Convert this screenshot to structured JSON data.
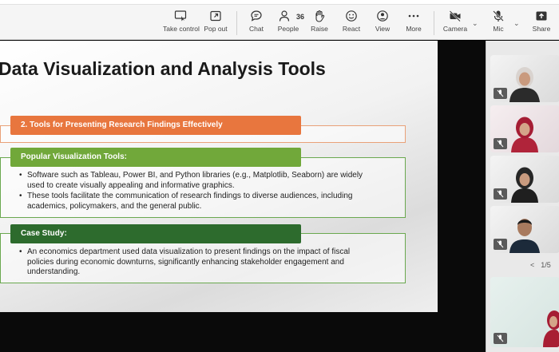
{
  "toolbar": {
    "take_control": "Take control",
    "pop_out": "Pop out",
    "chat": "Chat",
    "people": "People",
    "people_count": "36",
    "raise": "Raise",
    "react": "React",
    "view": "View",
    "more": "More",
    "camera": "Camera",
    "mic": "Mic",
    "share": "Share"
  },
  "slide": {
    "title": "Data Visualization and Analysis Tools",
    "section1": {
      "heading": "2. Tools for Presenting Research Findings Effectively"
    },
    "section2": {
      "heading": "Popular Visualization Tools:",
      "bullets": [
        "Software such as Tableau, Power BI, and Python libraries (e.g., Matplotlib, Seaborn) are widely used to create visually appealing and informative graphics.",
        "These tools facilitate the communication of research findings to diverse audiences, including academics, policymakers, and the general public."
      ]
    },
    "section3": {
      "heading": "Case Study:",
      "bullets": [
        "An economics department used data visualization to present findings on the impact of fiscal policies during economic downturns, significantly enhancing stakeholder engagement and understanding."
      ]
    }
  },
  "panel": {
    "pager_prev": "<",
    "pager_text": "1/5"
  }
}
